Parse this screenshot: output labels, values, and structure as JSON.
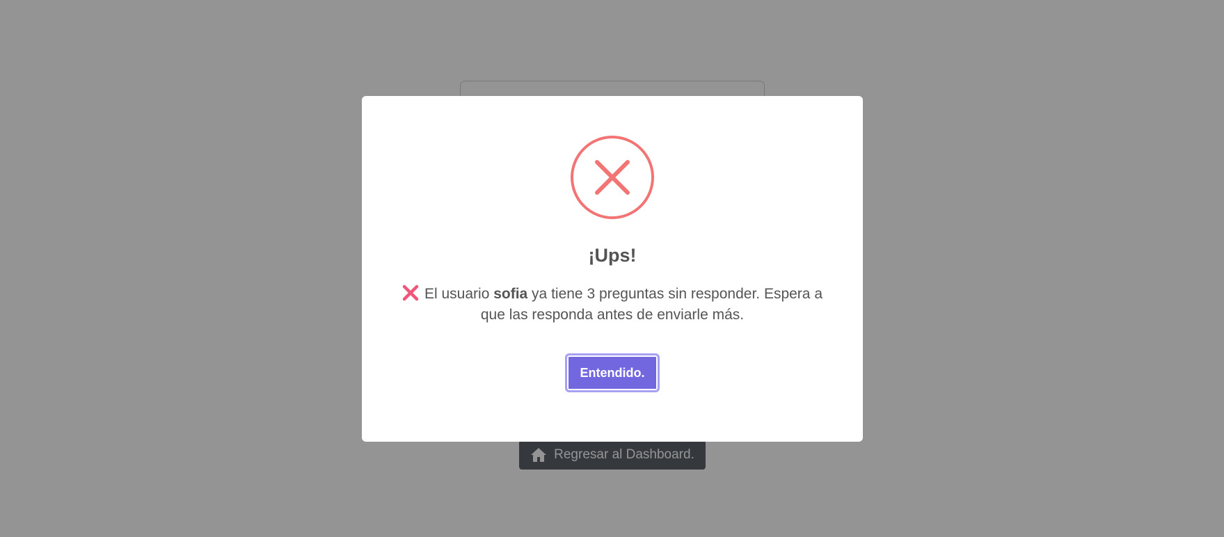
{
  "background": {
    "back_button_label": "Regresar al Dashboard.",
    "back_button_icon": "home-icon"
  },
  "modal": {
    "icon": "error-x-icon",
    "icon_color": "#f27474",
    "title": "¡Ups!",
    "message": {
      "prefix_icon": "cross-mark-icon",
      "before_user": "El usuario ",
      "username": "sofia",
      "after_user": " ya tiene 3 preguntas sin responder. Espera a que las responda antes de enviarle más."
    },
    "confirm_label": "Entendido.",
    "confirm_color": "#7367e0"
  }
}
